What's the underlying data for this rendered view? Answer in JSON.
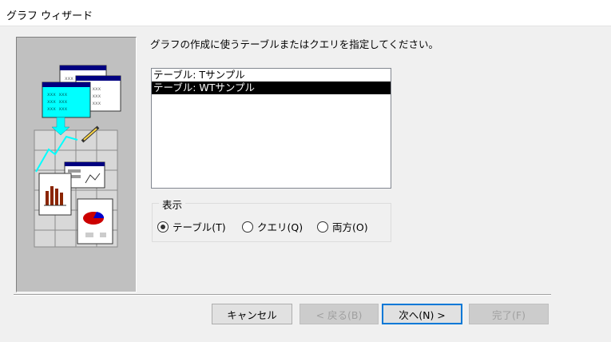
{
  "window": {
    "title": "グラフ ウィザード"
  },
  "instruction": "グラフの作成に使うテーブルまたはクエリを指定してください。",
  "list": {
    "items": [
      {
        "label": "テーブル: Tサンプル",
        "selected": false
      },
      {
        "label": "テーブル: WTサンプル",
        "selected": true
      }
    ]
  },
  "view_group": {
    "legend": "表示",
    "options": [
      {
        "label": "テーブル(T)",
        "checked": true
      },
      {
        "label": "クエリ(Q)",
        "checked": false
      },
      {
        "label": "両方(O)",
        "checked": false
      }
    ]
  },
  "buttons": {
    "cancel": "キャンセル",
    "back": "< 戻る(B)",
    "next": "次へ(N) >",
    "finish": "完了(F)"
  },
  "colors": {
    "selection_bg": "#000000",
    "illustration_bg": "#c0c0c0",
    "accent_cyan": "#00ffff",
    "default_button_border": "#0078d7"
  }
}
